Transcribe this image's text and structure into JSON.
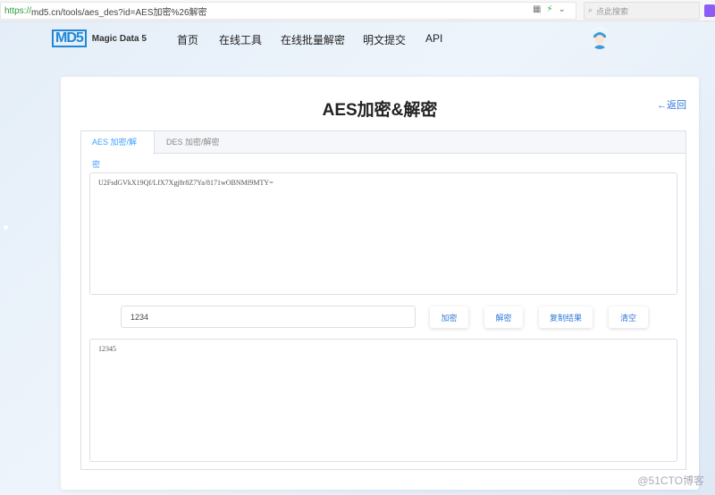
{
  "browser": {
    "url_scheme": "https://",
    "url_rest": "md5.cn/tools/aes_des?id=AES加密%26解密",
    "search_placeholder": "点此搜索"
  },
  "site": {
    "logo_mark": "MD5",
    "logo_text": "Magic Data 5",
    "nav": [
      "首页",
      "在线工具",
      "在线批量解密",
      "明文提交",
      "API"
    ]
  },
  "page": {
    "title": "AES加密&解密",
    "back_label": "←返回"
  },
  "tabs": [
    {
      "label": "AES 加密/解密",
      "active": true
    },
    {
      "label": "DES 加密/解密",
      "active": false
    }
  ],
  "form": {
    "input_text": "U2FsdGVkX19Qf/LfX7Xgj8r8Z7Ya/8171wOBNMf9MTY=",
    "key_value": "1234",
    "encrypt_label": "加密",
    "decrypt_label": "解密",
    "copy_label": "复制结果",
    "clear_label": "清空",
    "output_text": "12345"
  },
  "watermark": "@51CTO博客",
  "colors": {
    "accent": "#409eff",
    "link": "#2f7ad6",
    "background": "#e6eff8"
  }
}
